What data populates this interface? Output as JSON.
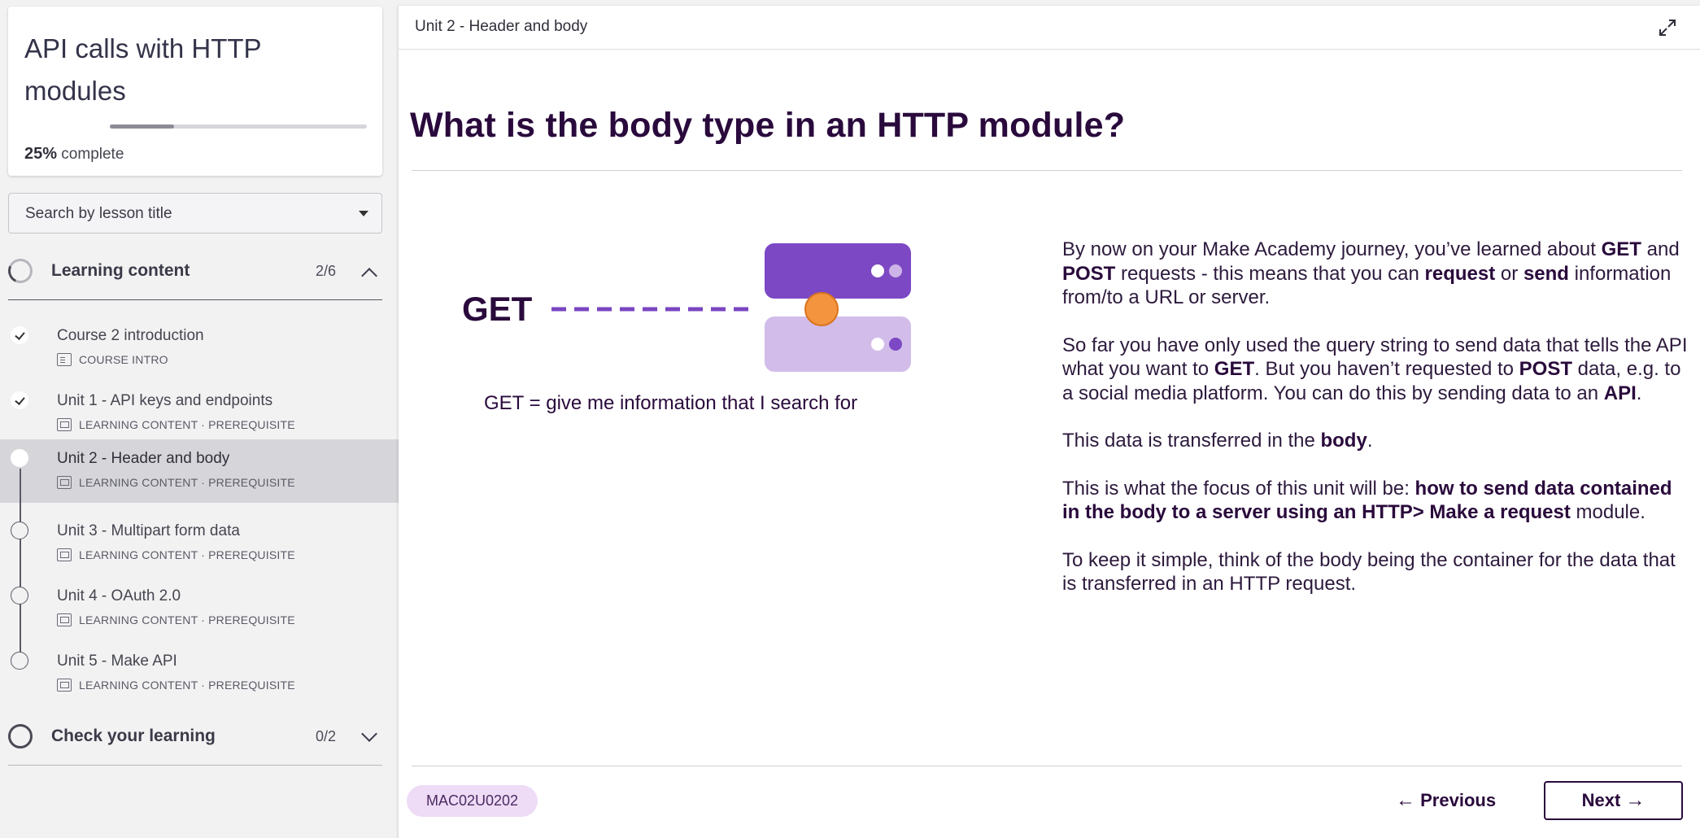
{
  "sidebar": {
    "course_title": "API calls with HTTP modules",
    "progress_percent": "25%",
    "progress_suffix": " complete",
    "progress_fraction": 0.25,
    "search": {
      "value": "Search by lesson title"
    },
    "sections": [
      {
        "label": "Learning content",
        "count": "2/6",
        "expanded": true,
        "lessons": [
          {
            "title": "Course 2 introduction",
            "meta": "COURSE INTRO",
            "icon": "document-icon",
            "completed": true,
            "active": false
          },
          {
            "title": "Unit 1 - API keys and endpoints",
            "meta": "LEARNING CONTENT · PREREQUISITE",
            "icon": "presentation-icon",
            "completed": true,
            "active": false
          },
          {
            "title": "Unit 2 - Header and body",
            "meta": "LEARNING CONTENT · PREREQUISITE",
            "icon": "presentation-icon",
            "completed": false,
            "active": true
          },
          {
            "title": "Unit 3 - Multipart form data",
            "meta": "LEARNING CONTENT · PREREQUISITE",
            "icon": "presentation-icon",
            "completed": false,
            "active": false
          },
          {
            "title": "Unit 4 - OAuth 2.0",
            "meta": "LEARNING CONTENT · PREREQUISITE",
            "icon": "presentation-icon",
            "completed": false,
            "active": false
          },
          {
            "title": "Unit 5 - Make API",
            "meta": "LEARNING CONTENT · PREREQUISITE",
            "icon": "presentation-icon",
            "completed": false,
            "active": false
          }
        ]
      },
      {
        "label": "Check your learning",
        "count": "0/2",
        "expanded": false
      }
    ]
  },
  "main": {
    "unit_title": "Unit 2 - Header and body",
    "heading": "What is the body type in an HTTP module?",
    "illustration": {
      "get_label": "GET",
      "caption": "GET = give me information that I search for"
    },
    "paragraphs": [
      [
        {
          "t": "By now on your Make Academy journey, you’ve learned about "
        },
        {
          "t": "GET",
          "b": true
        },
        {
          "t": " and "
        },
        {
          "t": "POST",
          "b": true
        },
        {
          "t": " requests - this means that you can "
        },
        {
          "t": "request",
          "b": true
        },
        {
          "t": " or "
        },
        {
          "t": "send",
          "b": true
        },
        {
          "t": " information from/to a URL or server."
        }
      ],
      [
        {
          "t": "So far you have only used the query string to send data that tells the API what you want to "
        },
        {
          "t": "GET",
          "b": true
        },
        {
          "t": ". But you haven’t requested to "
        },
        {
          "t": "POST",
          "b": true
        },
        {
          "t": " data, e.g. to a social media platform. You can do this by sending data to an "
        },
        {
          "t": "API",
          "b": true
        },
        {
          "t": "."
        }
      ],
      [
        {
          "t": "This data is transferred in the "
        },
        {
          "t": "body",
          "b": true
        },
        {
          "t": "."
        }
      ],
      [
        {
          "t": "This is what the focus of this unit will be: "
        },
        {
          "t": "how to send data contained in the body to a server using an HTTP> Make a request",
          "b": true
        },
        {
          "t": " module."
        }
      ],
      [
        {
          "t": "To keep it simple, think of the body being the container for the data that is transferred in an HTTP request."
        }
      ]
    ],
    "lesson_code": "MAC02U0202",
    "previous_label": "Previous",
    "next_label": "Next"
  },
  "colors": {
    "accent_purple": "#7a45c2",
    "light_purple": "#cdb4e8",
    "orange": "#f5943f",
    "heading_navy": "#2a0a3c"
  }
}
